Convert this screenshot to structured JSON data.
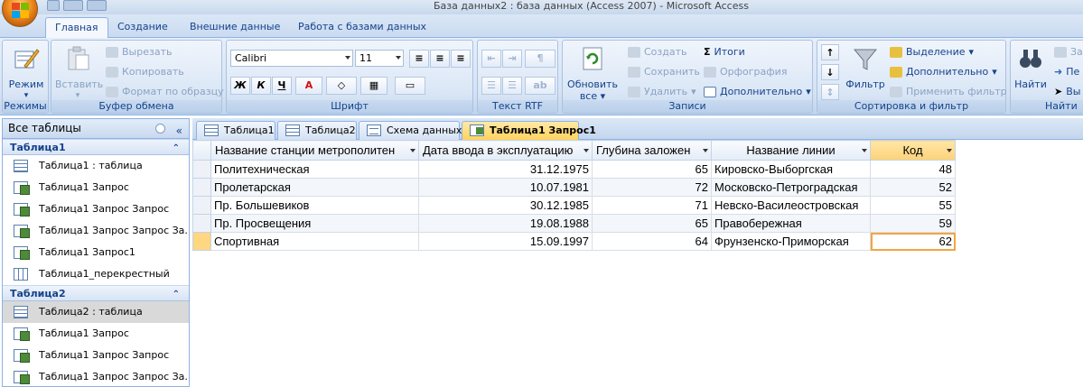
{
  "window": {
    "title": "База данных2 : база данных (Access 2007)  -  Microsoft Access"
  },
  "ribbon_tabs": [
    "Главная",
    "Создание",
    "Внешние данные",
    "Работа с базами данных"
  ],
  "groups": {
    "modes": {
      "label": "Режимы",
      "view": "Режим"
    },
    "clipboard": {
      "label": "Буфер обмена",
      "paste": "Вставить",
      "cut": "Вырезать",
      "copy": "Копировать",
      "format_painter": "Формат по образцу"
    },
    "font": {
      "label": "Шрифт",
      "font_name": "Calibri",
      "font_size": "11",
      "bold": "Ж",
      "italic": "К",
      "underline": "Ч",
      "font_color": "A"
    },
    "rich_text": {
      "label": "Текст RTF"
    },
    "records": {
      "label": "Записи",
      "refresh": "Обновить",
      "refresh2": "все",
      "new": "Создать",
      "save": "Сохранить",
      "delete": "Удалить",
      "totals": "Итоги",
      "spelling": "Орфография",
      "more": "Дополнительно"
    },
    "sort_filter": {
      "label": "Сортировка и фильтр",
      "filter": "Фильтр",
      "selection": "Выделение",
      "advanced": "Дополнительно",
      "apply": "Применить фильтр"
    },
    "find": {
      "label": "Найти",
      "find": "Найти",
      "replace": "За",
      "goto": "Пе",
      "select": "Вы"
    }
  },
  "nav_pane": {
    "header": "Все таблицы",
    "groups": [
      {
        "name": "Таблица1",
        "items": [
          {
            "label": "Таблица1 : таблица",
            "icon": "table-icon"
          },
          {
            "label": "Таблица1 Запрос",
            "icon": "query-icon"
          },
          {
            "label": "Таблица1 Запрос Запрос",
            "icon": "query-icon"
          },
          {
            "label": "Таблица1 Запрос Запрос За...",
            "icon": "query-icon"
          },
          {
            "label": "Таблица1 Запрос1",
            "icon": "query-icon"
          },
          {
            "label": "Таблица1_перекрестный",
            "icon": "crosstab-icon"
          }
        ]
      },
      {
        "name": "Таблица2",
        "items": [
          {
            "label": "Таблица2 : таблица",
            "icon": "table-icon",
            "selected": true
          },
          {
            "label": "Таблица1 Запрос",
            "icon": "query-icon"
          },
          {
            "label": "Таблица1 Запрос Запрос",
            "icon": "query-icon"
          },
          {
            "label": "Таблица1 Запрос Запрос За...",
            "icon": "query-icon"
          }
        ]
      }
    ]
  },
  "doc_tabs": [
    "Таблица1",
    "Таблица2",
    "Схема данных",
    "Таблица1 Запрос1"
  ],
  "datasheet": {
    "columns": [
      "Название станции метрополитен",
      "Дата ввода в эксплуатацию",
      "Глубина заложен",
      "Название линии",
      "Код"
    ],
    "rows": [
      [
        "Политехническая",
        "31.12.1975",
        "65",
        "Кировско-Выборгская",
        "48"
      ],
      [
        "Пролетарская",
        "10.07.1981",
        "72",
        "Московско-Петроградская",
        "52"
      ],
      [
        "Пр. Большевиков",
        "30.12.1985",
        "71",
        "Невско-Василеостровская",
        "55"
      ],
      [
        "Пр. Просвещения",
        "19.08.1988",
        "65",
        "Правобережная",
        "59"
      ],
      [
        "Спортивная",
        "15.09.1997",
        "64",
        "Фрунзенско-Приморская",
        "62"
      ]
    ]
  },
  "colors": {
    "accent": "#15428b",
    "active_tab": "#ffd35c",
    "ribbon_bg": "#dbe7f6"
  }
}
